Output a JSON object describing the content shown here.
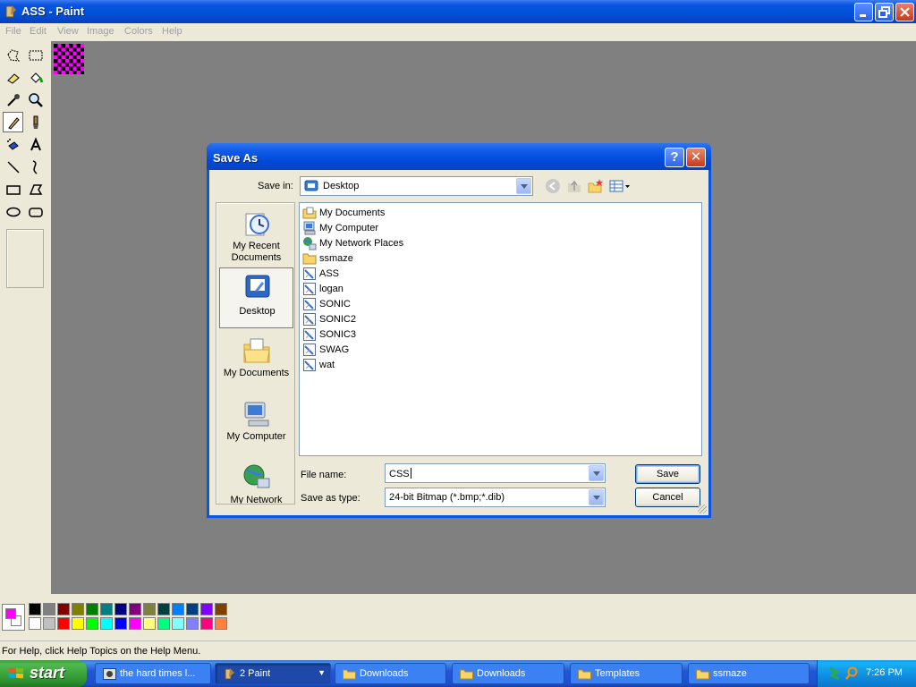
{
  "window": {
    "title": "ASS - Paint"
  },
  "menu": [
    "File",
    "Edit",
    "View",
    "Image",
    "Colors",
    "Help"
  ],
  "toolbox": {
    "tools": [
      "free-form-select",
      "select",
      "eraser",
      "fill-with-color",
      "pick-color",
      "magnifier",
      "pencil",
      "brush",
      "airbrush",
      "text",
      "line",
      "curve",
      "rectangle",
      "polygon",
      "ellipse",
      "rounded-rectangle"
    ],
    "selected": "pencil"
  },
  "palette": {
    "foreground": "#ff00ff",
    "background": "#ffffff",
    "row1": [
      "#000000",
      "#808080",
      "#800000",
      "#808000",
      "#008000",
      "#008080",
      "#000080",
      "#800080",
      "#808040",
      "#004040",
      "#0080ff",
      "#004080",
      "#8000ff",
      "#804000"
    ],
    "row2": [
      "#ffffff",
      "#c0c0c0",
      "#ff0000",
      "#ffff00",
      "#00ff00",
      "#00ffff",
      "#0000ff",
      "#ff00ff",
      "#ffff80",
      "#00ff80",
      "#80ffff",
      "#8080ff",
      "#ff0080",
      "#ff8040"
    ]
  },
  "status": {
    "text": "For Help, click Help Topics on the Help Menu."
  },
  "dialog": {
    "title": "Save As",
    "help_label": "?",
    "close_label": "✕",
    "save_in_label": "Save in:",
    "save_in_value": "Desktop",
    "places": [
      {
        "label": "My Recent Documents",
        "icon": "recent-documents-icon"
      },
      {
        "label": "Desktop",
        "icon": "desktop-icon"
      },
      {
        "label": "My Documents",
        "icon": "my-documents-icon"
      },
      {
        "label": "My Computer",
        "icon": "my-computer-icon"
      },
      {
        "label": "My Network",
        "icon": "my-network-icon"
      }
    ],
    "files": [
      {
        "name": "My Documents",
        "type": "folder-docs"
      },
      {
        "name": "My Computer",
        "type": "computer"
      },
      {
        "name": "My Network Places",
        "type": "network"
      },
      {
        "name": "ssmaze",
        "type": "folder"
      },
      {
        "name": "ASS",
        "type": "bitmap"
      },
      {
        "name": "logan",
        "type": "bitmap"
      },
      {
        "name": "SONIC",
        "type": "bitmap"
      },
      {
        "name": "SONIC2",
        "type": "bitmap"
      },
      {
        "name": "SONIC3",
        "type": "bitmap"
      },
      {
        "name": "SWAG",
        "type": "bitmap"
      },
      {
        "name": "wat",
        "type": "bitmap"
      }
    ],
    "file_name_label": "File name:",
    "file_name_value": "CSS",
    "save_type_label": "Save as type:",
    "save_type_value": "24-bit Bitmap (*.bmp;*.dib)",
    "save_button": "Save",
    "cancel_button": "Cancel"
  },
  "taskbar": {
    "start_label": "start",
    "tasks": [
      {
        "label": "the hard times l...",
        "icon": "browser-icon"
      },
      {
        "label": "2 Paint",
        "icon": "paint-icon"
      },
      {
        "label": "Downloads",
        "icon": "folder-icon"
      },
      {
        "label": "Downloads",
        "icon": "folder-icon"
      },
      {
        "label": "Templates",
        "icon": "folder-icon"
      },
      {
        "label": "ssmaze",
        "icon": "folder-icon"
      }
    ],
    "clock": "7:26 PM"
  }
}
